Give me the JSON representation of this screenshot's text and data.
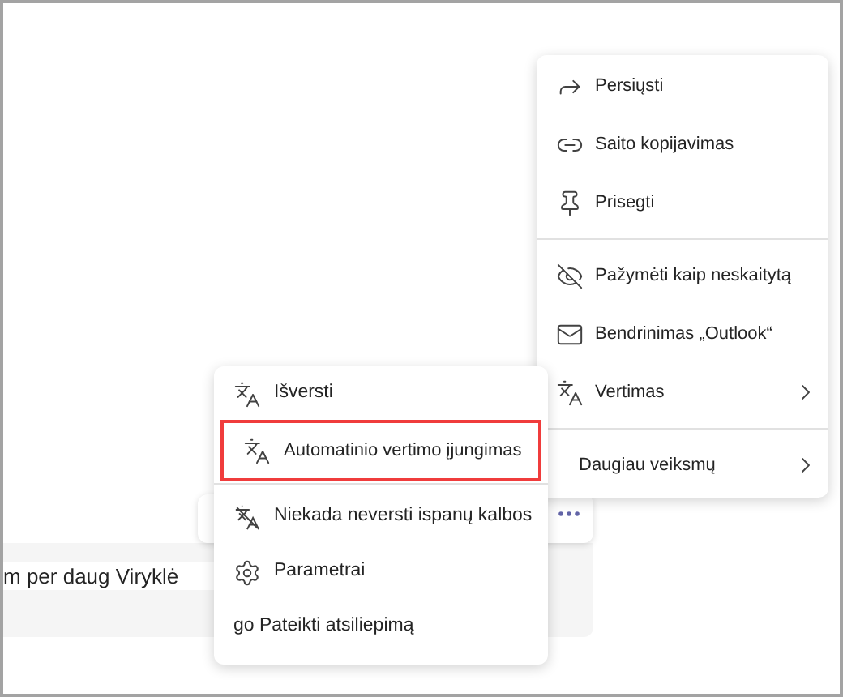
{
  "message": {
    "text": "m per daug Viryklė"
  },
  "message_menu": {
    "sections": [
      {
        "items": [
          {
            "label": "Persiųsti",
            "has_submenu": false
          },
          {
            "label": "Saito kopijavimas",
            "has_submenu": false
          },
          {
            "label": "Prisegti",
            "has_submenu": false
          }
        ]
      },
      {
        "items": [
          {
            "label": "Pažymėti kaip neskaitytą",
            "has_submenu": false
          },
          {
            "label": "Bendrinimas „Outlook“",
            "has_submenu": false
          },
          {
            "label": "Vertimas",
            "has_submenu": true
          }
        ]
      },
      {
        "items": [
          {
            "label": "Daugiau veiksmų",
            "has_submenu": true
          }
        ]
      }
    ]
  },
  "translate_menu": {
    "sections": [
      {
        "items": [
          {
            "label": "Išversti",
            "highlighted": false
          },
          {
            "label": "Automatinio vertimo įjungimas",
            "highlighted": true
          }
        ]
      },
      {
        "items": [
          {
            "label": "Niekada neversti ispanų kalbos",
            "highlighted": false
          },
          {
            "label": "Parametrai",
            "highlighted": false
          },
          {
            "label": "go Pateikti atsiliepimą",
            "highlighted": false
          }
        ]
      }
    ]
  }
}
